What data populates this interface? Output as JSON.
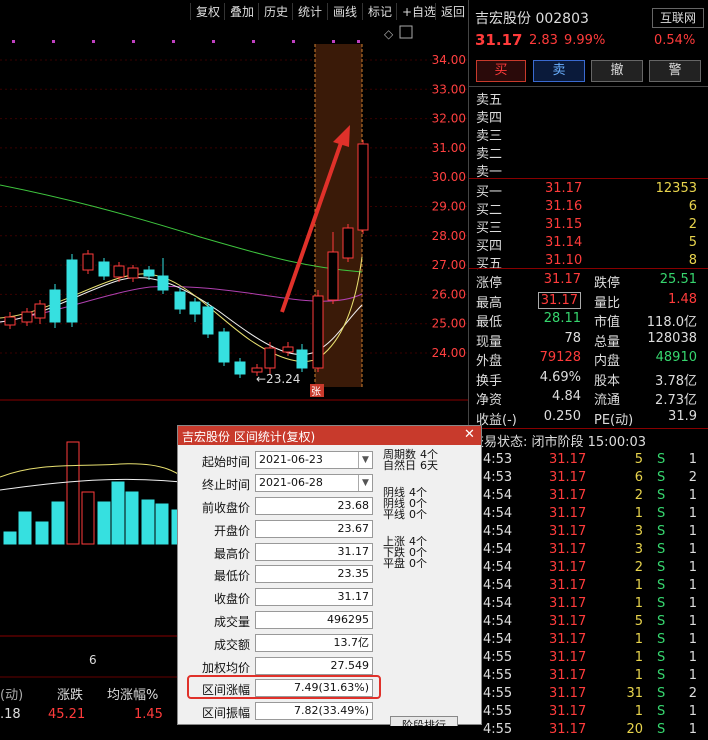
{
  "toolbar": {
    "items": [
      "复权",
      "叠加",
      "历史",
      "统计",
      "画线",
      "标记",
      "+自选",
      "返回"
    ]
  },
  "chart": {
    "price_ticks": [
      "34.00",
      "33.00",
      "32.00",
      "31.00",
      "30.00",
      "29.00",
      "28.00",
      "27.00",
      "26.00",
      "25.00",
      "24.00"
    ],
    "low_label": "←23.24",
    "limit_mark": "张",
    "bottom_tick": "6"
  },
  "bottom_left": {
    "h1": "涨跌",
    "h2": "均涨幅%",
    "v0": ".18",
    "v1": "45.21",
    "v2": "1.45",
    "left_label": "(动)"
  },
  "stock": {
    "name": "吉宏股份",
    "code": "002803",
    "price": "31.17",
    "change": "2.83",
    "pct": "9.99%",
    "tag": "互联网",
    "tag_pct": "0.54%"
  },
  "actions": [
    "买",
    "卖",
    "撤",
    "警"
  ],
  "sells": [
    "卖五",
    "卖四",
    "卖三",
    "卖二",
    "卖一"
  ],
  "buys": [
    {
      "label": "买一",
      "price": "31.17",
      "vol": "12353"
    },
    {
      "label": "买二",
      "price": "31.16",
      "vol": "6"
    },
    {
      "label": "买三",
      "price": "31.15",
      "vol": "2"
    },
    {
      "label": "买四",
      "price": "31.14",
      "vol": "5"
    },
    {
      "label": "买五",
      "price": "31.10",
      "vol": "8"
    }
  ],
  "quote": [
    {
      "l1": "涨停",
      "v1": "31.17",
      "l2": "跌停",
      "v2": "25.51"
    },
    {
      "l1": "最高",
      "v1": "31.17",
      "l2": "量比",
      "v2": "1.48"
    },
    {
      "l1": "最低",
      "v1": "28.11",
      "l2": "市值",
      "v2": "118.0亿"
    },
    {
      "l1": "现量",
      "v1": "78",
      "l2": "总量",
      "v2": "128038"
    },
    {
      "l1": "外盘",
      "v1": "79128",
      "l2": "内盘",
      "v2": "48910"
    },
    {
      "l1": "换手",
      "v1": "4.69%",
      "l2": "股本",
      "v2": "3.78亿"
    },
    {
      "l1": "净资",
      "v1": "4.84",
      "l2": "流通",
      "v2": "2.73亿"
    },
    {
      "l1": "收益(-)",
      "v1": "0.250",
      "l2": "PE(动)",
      "v2": "31.9"
    }
  ],
  "trade_status": "交易状态: 闭市阶段 15:00:03",
  "ticks": [
    {
      "t": "4:53",
      "p": "31.17",
      "v": "5",
      "s": "S",
      "n": "1"
    },
    {
      "t": "4:53",
      "p": "31.17",
      "v": "6",
      "s": "S",
      "n": "2"
    },
    {
      "t": "4:54",
      "p": "31.17",
      "v": "2",
      "s": "S",
      "n": "1"
    },
    {
      "t": "4:54",
      "p": "31.17",
      "v": "1",
      "s": "S",
      "n": "1"
    },
    {
      "t": "4:54",
      "p": "31.17",
      "v": "3",
      "s": "S",
      "n": "1"
    },
    {
      "t": "4:54",
      "p": "31.17",
      "v": "3",
      "s": "S",
      "n": "1"
    },
    {
      "t": "4:54",
      "p": "31.17",
      "v": "2",
      "s": "S",
      "n": "1"
    },
    {
      "t": "4:54",
      "p": "31.17",
      "v": "1",
      "s": "S",
      "n": "1"
    },
    {
      "t": "4:54",
      "p": "31.17",
      "v": "1",
      "s": "S",
      "n": "1"
    },
    {
      "t": "4:54",
      "p": "31.17",
      "v": "5",
      "s": "S",
      "n": "1"
    },
    {
      "t": "4:54",
      "p": "31.17",
      "v": "1",
      "s": "S",
      "n": "1"
    },
    {
      "t": "4:55",
      "p": "31.17",
      "v": "1",
      "s": "S",
      "n": "1"
    },
    {
      "t": "4:55",
      "p": "31.17",
      "v": "1",
      "s": "S",
      "n": "1"
    },
    {
      "t": "4:55",
      "p": "31.17",
      "v": "31",
      "s": "S",
      "n": "2"
    },
    {
      "t": "4:55",
      "p": "31.17",
      "v": "1",
      "s": "S",
      "n": "1"
    },
    {
      "t": "4:55",
      "p": "31.17",
      "v": "20",
      "s": "S",
      "n": "1"
    }
  ],
  "dialog": {
    "title": "吉宏股份 区间统计(复权)",
    "start_label": "起始时间",
    "start_value": "2021-06-23",
    "end_label": "终止时间",
    "end_value": "2021-06-28",
    "rows": [
      {
        "label": "前收盘价",
        "value": "23.68"
      },
      {
        "label": "开盘价",
        "value": "23.67"
      },
      {
        "label": "最高价",
        "value": "31.17"
      },
      {
        "label": "最低价",
        "value": "23.35"
      },
      {
        "label": "收盘价",
        "value": "31.17"
      },
      {
        "label": "成交量",
        "value": "496295"
      },
      {
        "label": "成交额",
        "value": "13.7亿"
      },
      {
        "label": "加权均价",
        "value": "27.549"
      },
      {
        "label": "区间涨幅",
        "value": "7.49(31.63%)"
      },
      {
        "label": "区间振幅",
        "value": "7.82(33.49%)"
      }
    ],
    "period_label": "周期数",
    "period_value": "4个",
    "natural_label": "自然日",
    "natural_value": "6天",
    "yin_label": "阴线",
    "yin_value": "4个",
    "yinx_label": "阴线",
    "yinx_value": "0个",
    "flat_label": "平线",
    "flat_value": "0个",
    "up_label": "上涨",
    "up_value": "4个",
    "down_label": "下跌",
    "down_value": "0个",
    "even_label": "平盘",
    "even_value": "0个",
    "button": "阶段排行"
  },
  "colors": {
    "up": "#ff3b3b",
    "down": "#36e0e0",
    "accent": "#c83a2c"
  }
}
